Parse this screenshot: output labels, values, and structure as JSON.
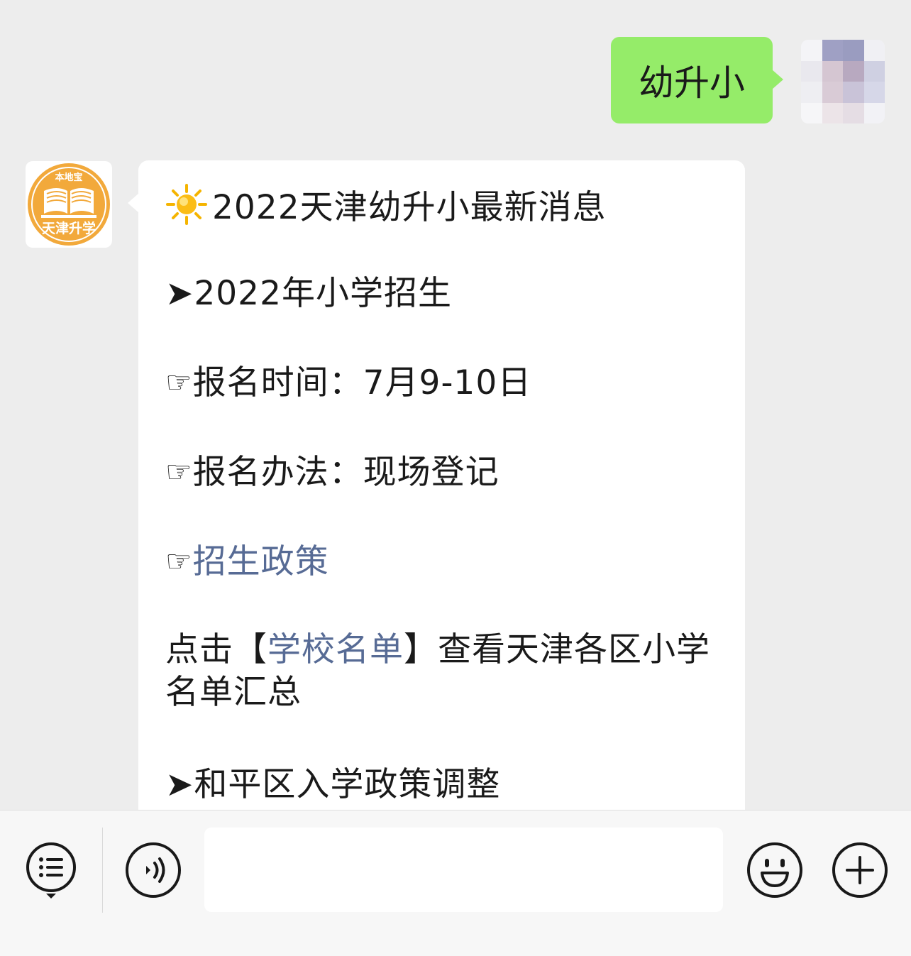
{
  "chat": {
    "outgoing_message": "幼升小",
    "bot_avatar": {
      "top_text": "本地宝",
      "bottom_text": "天津升学",
      "brand_color": "#f2a93b"
    },
    "reply": {
      "title": "2022天津幼升小最新消息",
      "section1": "➤2022年小学招生",
      "item_time_label": "报名时间：7月9-10日",
      "item_method_label": "报名办法：现场登记",
      "item_policy_link": "招生政策",
      "hand_glyph": "☞",
      "para_prefix": "点击【",
      "para_link": "学校名单",
      "para_suffix": "】查看天津各区小学名单汇总",
      "section2": "➤和平区入学政策调整"
    }
  },
  "colors": {
    "background": "#ededed",
    "outgoing_bubble": "#95ec69",
    "link": "#576b95"
  },
  "input_bar": {
    "menu_icon": "menu-list-icon",
    "voice_icon": "voice-icon",
    "emoji_icon": "emoji-icon",
    "add_icon": "plus-icon",
    "input_value": ""
  }
}
